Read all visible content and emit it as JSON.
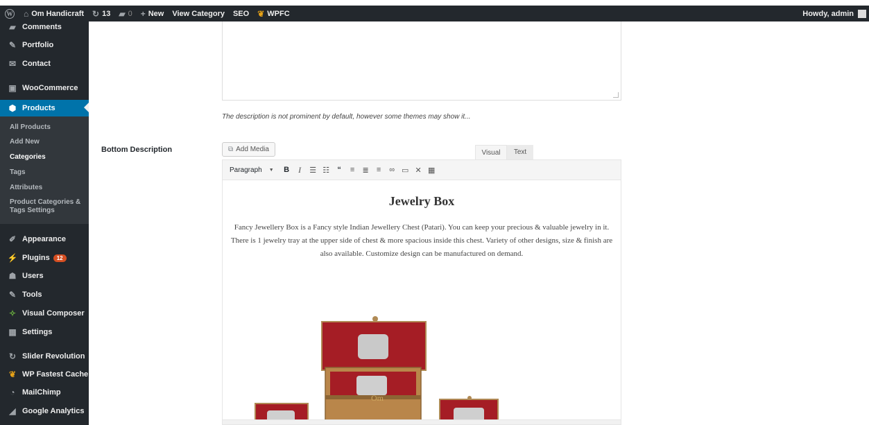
{
  "admin_bar": {
    "site_name": "Om Handicraft",
    "updates_count": "13",
    "comments_count": "0",
    "new_label": "New",
    "view_category_label": "View Category",
    "seo_label": "SEO",
    "wpfc_label": "WPFC",
    "greeting": "Howdy, admin"
  },
  "sidebar": {
    "items": [
      {
        "label": "Comments",
        "icon": "comment-icon"
      },
      {
        "label": "Portfolio",
        "icon": "pin-icon"
      },
      {
        "label": "Contact",
        "icon": "envelope-icon"
      },
      {
        "label": "WooCommerce",
        "icon": "woo-icon"
      },
      {
        "label": "Products",
        "icon": "cube-icon"
      }
    ],
    "submenu": [
      {
        "label": "All Products"
      },
      {
        "label": "Add New"
      },
      {
        "label": "Categories"
      },
      {
        "label": "Tags"
      },
      {
        "label": "Attributes"
      },
      {
        "label": "Product Categories & Tags Settings"
      }
    ],
    "items_after": [
      {
        "label": "Appearance",
        "icon": "brush-icon"
      },
      {
        "label": "Plugins",
        "icon": "plug-icon",
        "badge": "12"
      },
      {
        "label": "Users",
        "icon": "user-icon"
      },
      {
        "label": "Tools",
        "icon": "wrench-icon"
      },
      {
        "label": "Visual Composer",
        "icon": "vc-icon"
      },
      {
        "label": "Settings",
        "icon": "settings-icon"
      },
      {
        "label": "Slider Revolution",
        "icon": "refresh-icon"
      },
      {
        "label": "WP Fastest Cache",
        "icon": "cheetah-icon"
      },
      {
        "label": "MailChimp",
        "icon": "mailchimp-icon"
      },
      {
        "label": "Google Analytics",
        "icon": "chart-icon"
      }
    ]
  },
  "main": {
    "description_note": "The description is not prominent by default, however some themes may show it...",
    "field_label": "Bottom Description",
    "add_media_label": "Add Media",
    "tab_visual": "Visual",
    "tab_text": "Text",
    "format_select": "Paragraph",
    "editor_heading": "Jewelry Box",
    "editor_paragraph": "Fancy Jewellery Box is a Fancy style Indian Jewellery Chest (Patari). You can keep your precious & valuable jewelry in it. There is 1 jewelry tray at the upper side of chest & more spacious inside this chest. Variety of other designs, size & finish are also available. Customize design can be manufactured on demand."
  },
  "colors": {
    "admin_bar_bg": "#23282d",
    "active_menu": "#0073aa",
    "badge": "#d54e21"
  }
}
